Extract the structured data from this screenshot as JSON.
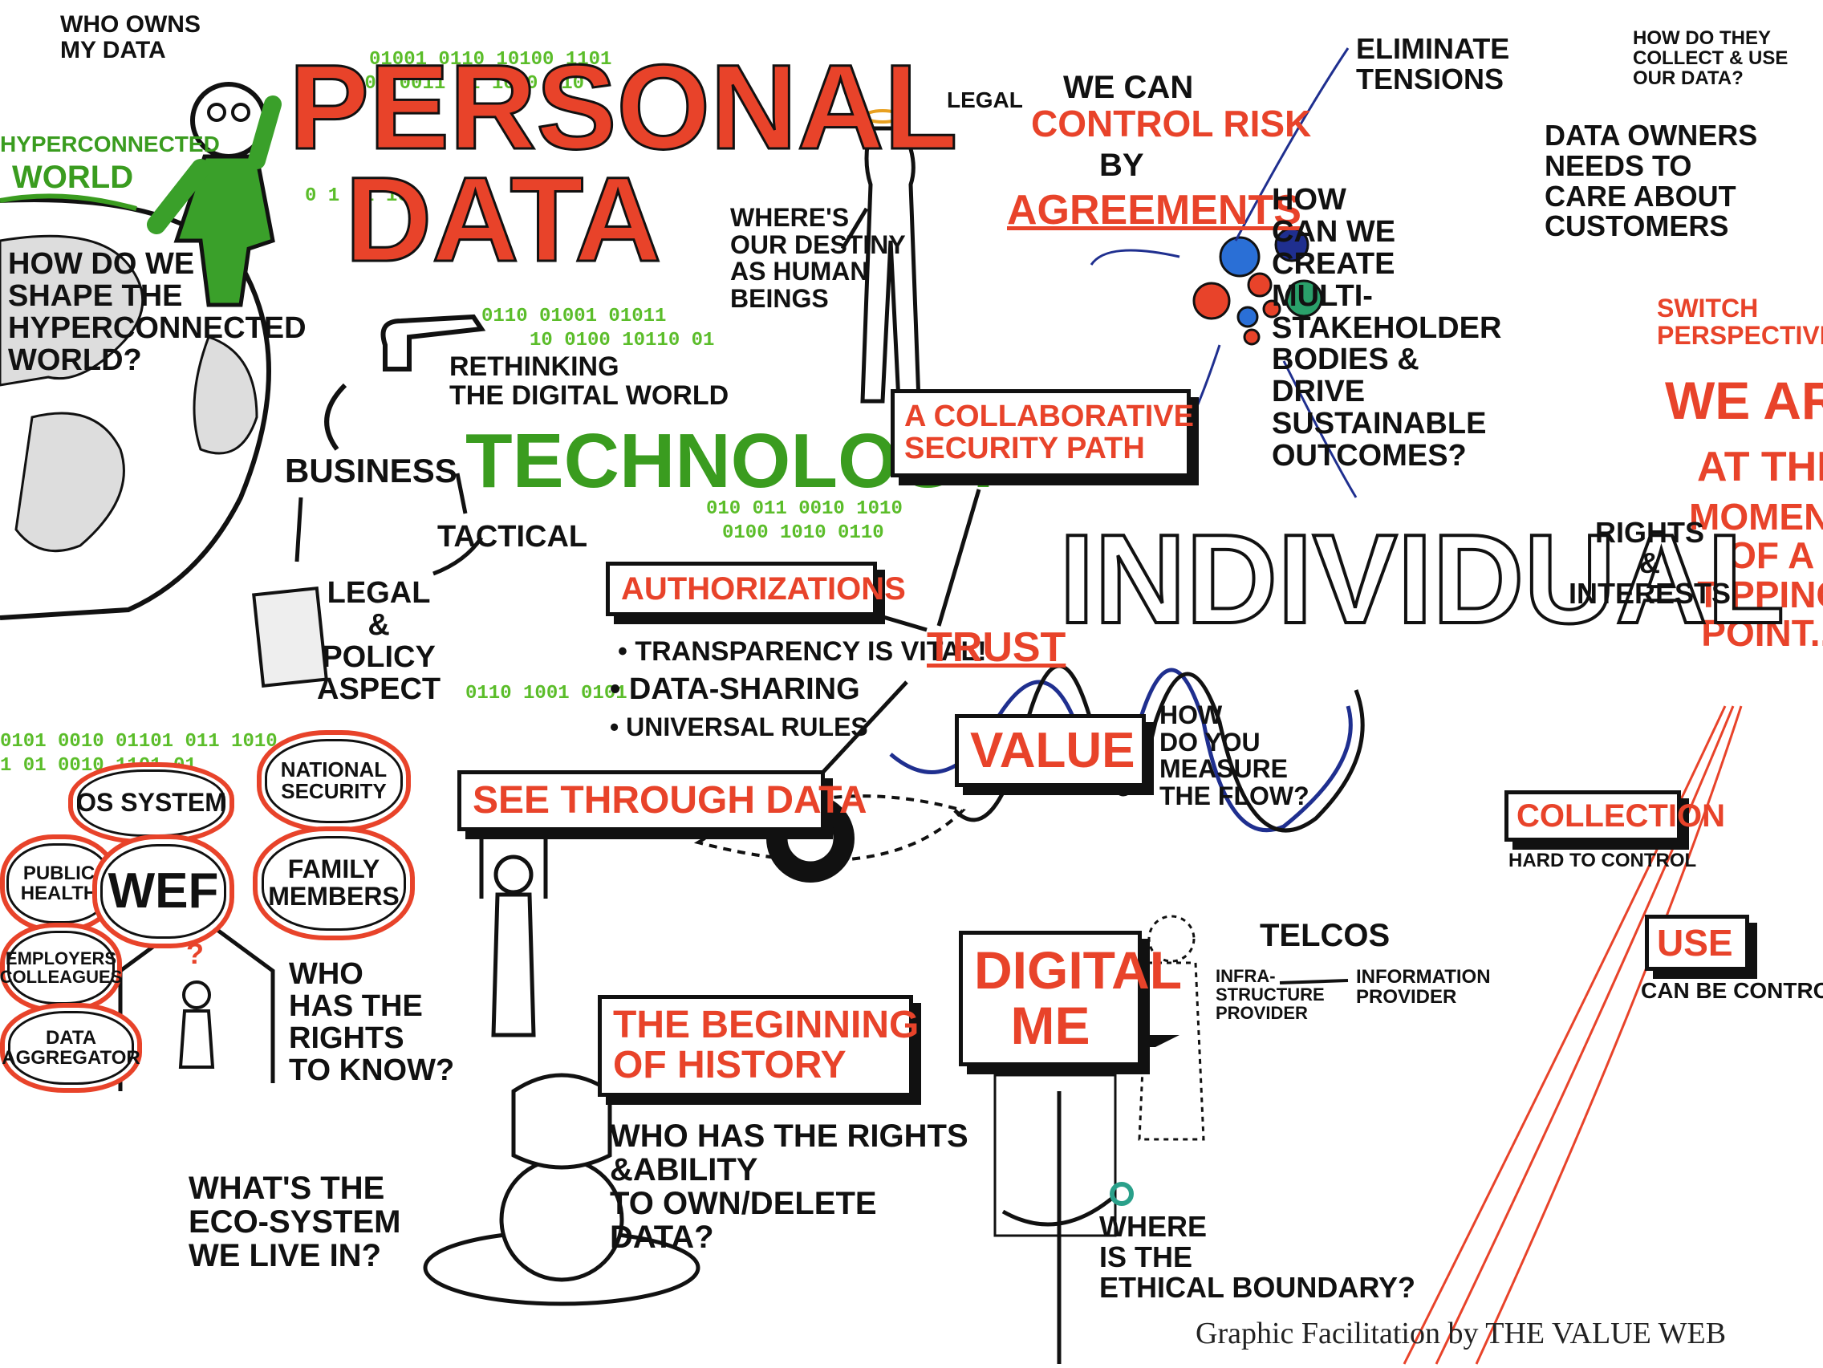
{
  "colors": {
    "red": "#e8432a",
    "green": "#3a9c1f",
    "blue": "#1f2f8f",
    "ink": "#111111"
  },
  "title": {
    "line1": "PERSONAL",
    "line2": "DATA"
  },
  "who_owns": "WHO OWNS\nMY DATA",
  "hyperconnected": {
    "line1": "HYPERCONNECTED",
    "line2": "WORLD"
  },
  "shape_question": "HOW DO WE\nSHAPE the\nHYPERCONNECTED\nWORLD?",
  "rethinking": "RETHINKING\nthe DIGITAL WORLD",
  "business": "BUSINESS",
  "technology": "TECHNOLOGY",
  "tactical": "TACTICAL",
  "legal_policy": "LEGAL\n&\nPOLICY\nASPECT",
  "destiny": "WHERE'S\nOUR DESTINY\nAS HUMAN\nBEINGS",
  "collab_path": "A COLLABORATIVE\nSECURITY PATH",
  "legal_small": "LEGAL",
  "control_risk": {
    "l1": "WE CAN",
    "l2": "CONTROL RISK",
    "l3": "BY",
    "l4": "AGREEMENTS"
  },
  "eliminate": "ELIMINATE\nTENSIONS",
  "multi_stakeholder": "HOW\nCAN WE\nCREATE\nMULTI-\nSTAKEHOLDER\nBODIES &\nDRIVE\nSUSTAINABLE\nOUTCOMES?",
  "how_collect": "HOW DO THEY\nCOLLECT & USE\nOUR DATA?",
  "data_owners": "DATA OWNERS\nNEEDS TO\nCARE ABOUT\nCUSTOMERS",
  "switch": "SWITCH\nPERSPECTIVES",
  "tipping": {
    "l1": "WE ARE",
    "l2": "AT the",
    "l3": "MOMENT\nOF A\nTIPPING\nPOINT..."
  },
  "individual": "INDIVIDUAL",
  "rights_interests": "RIGHTS\n&\nINTERESTS",
  "authorizations": "AUTHORIZATIONS",
  "bullets": [
    "TRANSPARENCY IS VITAL!",
    "DATA-SHARING",
    "UNIVERSAL RULES"
  ],
  "trust": "TRUST",
  "value": "VALUE",
  "measure": "HOW\nDO YOU\nMEASURE\nTHE FLOW?",
  "see_through": "SEE THROUGH DATA",
  "collection": "COLLECTION",
  "hard_control": "HARD TO CONTROL",
  "use": "USE",
  "can_control": "CAN BE CONTROLLED",
  "clouds": {
    "os": "OS SYSTEM",
    "national": "NATIONAL\nSECURITY",
    "public": "PUBLIC\nHEALTH",
    "wef": "WEF",
    "family": "FAMILY\nMEMBERS",
    "employers": "EMPLOYERS\nCOLLEAGUES",
    "aggregator": "DATA\nAGGREGATOR"
  },
  "who_rights": "WHO\nHAS the\nRIGHTS\nto KNOW?",
  "ecosystem": "WHAT'S the\nECO-SYSTEM\nWE LIVE IN?",
  "beginning": "THE BEGINNING\nOF HISTORY",
  "own_delete": "WHO HAS THE RIGHTS\n&ABILITY\nTO OWN/DELETE\nDATA?",
  "digital_me": "DIGITAL\nME",
  "telcos": "TELCOs",
  "infra": "INFRA-\nSTRUCTURE\nPROVIDER",
  "info_provider": "INFORMATION\nPROVIDER",
  "ethical": "WHERE\nis the\nETHICAL BOUNDARY?",
  "credit": "Graphic Facilitation by THE VALUE WEB"
}
